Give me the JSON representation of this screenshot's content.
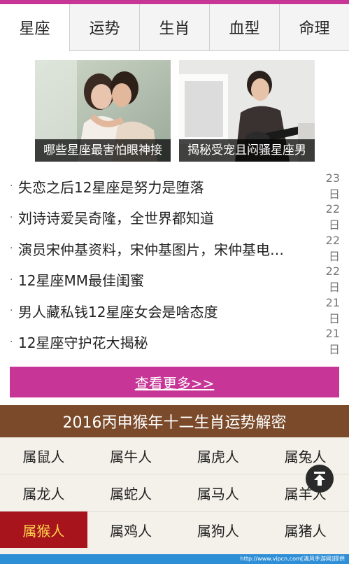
{
  "tabs": [
    {
      "label": "星座",
      "active": true
    },
    {
      "label": "运势",
      "active": false
    },
    {
      "label": "生肖",
      "active": false
    },
    {
      "label": "血型",
      "active": false
    },
    {
      "label": "命理",
      "active": false
    }
  ],
  "featured": [
    {
      "caption": "哪些星座最害怕眼神接"
    },
    {
      "caption": "揭秘受宠且闷骚星座男"
    }
  ],
  "news": [
    {
      "title": "失恋之后12星座是努力是堕落",
      "date": "23日"
    },
    {
      "title": "刘诗诗爱吴奇隆，全世界都知道",
      "date": "22日"
    },
    {
      "title": "演员宋仲基资料，宋仲基图片，宋仲基电…",
      "date": "22日"
    },
    {
      "title": "12星座MM最佳闺蜜",
      "date": "22日"
    },
    {
      "title": "男人藏私钱12星座女会是啥态度",
      "date": "21日"
    },
    {
      "title": "12星座守护花大揭秘",
      "date": "21日"
    }
  ],
  "more_label": "查看更多>>",
  "banner_title": "2016丙申猴年十二生肖运势解密",
  "zodiac": [
    [
      "属鼠人",
      "属牛人",
      "属虎人",
      "属兔人"
    ],
    [
      "属龙人",
      "属蛇人",
      "属马人",
      "属羊人"
    ],
    [
      "属猴人",
      "属鸡人",
      "属狗人",
      "属猪人"
    ]
  ],
  "zodiac_selected": "属猴人",
  "footer_text": "http://www.vipcn.com[清风手游网]提供",
  "colors": {
    "accent": "#c73597",
    "banner": "#7a4a2a",
    "selected": "#a7141b"
  }
}
